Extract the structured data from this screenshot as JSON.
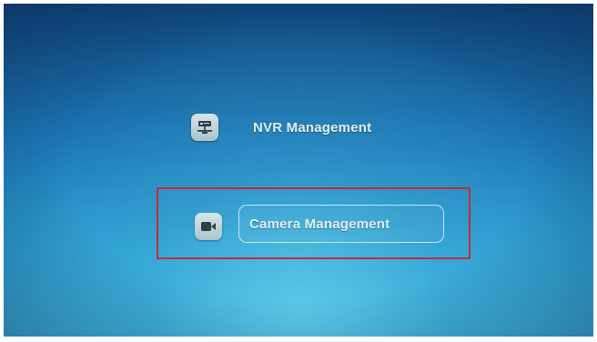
{
  "menu": {
    "items": [
      {
        "label": "NVR Management",
        "icon": "network-device-icon",
        "selected": false
      },
      {
        "label": "Camera Management",
        "icon": "video-camera-icon",
        "selected": true
      }
    ]
  },
  "colors": {
    "background_top": "#10487f",
    "background_bottom": "#3fb5df",
    "label_text": "#e4f0f5",
    "highlight_box": "#c8283a"
  }
}
